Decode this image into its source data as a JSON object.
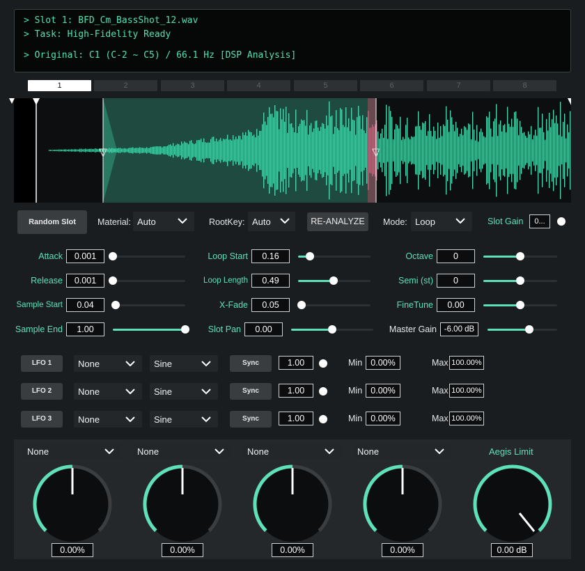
{
  "console": {
    "line1": "> Slot 1: BFD_Cm_BassShot_12.wav",
    "line2": "> Task: High-Fidelity Ready",
    "line3": "> Original: C1 (C-2 ~ C5) / 66.1 Hz [DSP Analysis]"
  },
  "slots": [
    "1",
    "2",
    "3",
    "4",
    "5",
    "6",
    "7",
    "8"
  ],
  "active_slot": "1",
  "controls": {
    "random_slot": "Random Slot",
    "material_label": "Material:",
    "material_value": "Auto",
    "rootkey_label": "RootKey:",
    "rootkey_value": "Auto",
    "reanalyze": "RE-ANALYZE",
    "mode_label": "Mode:",
    "mode_value": "Loop",
    "slot_gain_label": "Slot Gain",
    "slot_gain_value": "0..."
  },
  "params": {
    "attack": {
      "label": "Attack",
      "value": "0.001",
      "level": 0.0
    },
    "release": {
      "label": "Release",
      "value": "0.001",
      "level": 0.0
    },
    "sample_start": {
      "label": "Sample Start",
      "value": "0.04",
      "level": 0.04
    },
    "sample_end": {
      "label": "Sample End",
      "value": "1.00",
      "level": 1.0
    },
    "loop_start": {
      "label": "Loop Start",
      "value": "0.16",
      "level": 0.16
    },
    "loop_length": {
      "label": "Loop Length",
      "value": "0.49",
      "level": 0.49
    },
    "xfade": {
      "label": "X-Fade",
      "value": "0.05",
      "level": 0.05
    },
    "slot_pan": {
      "label": "Slot Pan",
      "value": "0.00",
      "level": 0.5
    },
    "octave": {
      "label": "Octave",
      "value": "0",
      "level": 0.5
    },
    "semi": {
      "label": "Semi (st)",
      "value": "0",
      "level": 0.5
    },
    "finetune": {
      "label": "FineTune",
      "value": "0.00",
      "level": 0.5
    },
    "master_gain": {
      "label": "Master Gain",
      "value": "-6.00 dB",
      "level": 0.6
    }
  },
  "lfos": [
    {
      "name": "LFO 1",
      "target": "None",
      "shape": "Sine",
      "sync": "Sync",
      "rate": "1.00",
      "min_label": "Min",
      "min": "0.00%",
      "max_label": "Max",
      "max": "100.00%"
    },
    {
      "name": "LFO 2",
      "target": "None",
      "shape": "Sine",
      "sync": "Sync",
      "rate": "1.00",
      "min_label": "Min",
      "min": "0.00%",
      "max_label": "Max",
      "max": "100.00%"
    },
    {
      "name": "LFO 3",
      "target": "None",
      "shape": "Sine",
      "sync": "Sync",
      "rate": "1.00",
      "min_label": "Min",
      "min": "0.00%",
      "max_label": "Max",
      "max": "100.00%"
    }
  ],
  "macros": [
    {
      "target": "None",
      "value": "0.00%"
    },
    {
      "target": "None",
      "value": "0.00%"
    },
    {
      "target": "None",
      "value": "0.00%"
    },
    {
      "target": "None",
      "value": "0.00%"
    }
  ],
  "aegis": {
    "label": "Aegis Limit",
    "value": "0.00 dB"
  },
  "colors": {
    "accent": "#5ee0b8",
    "panel": "#24282b",
    "background": "#1a1d20"
  }
}
